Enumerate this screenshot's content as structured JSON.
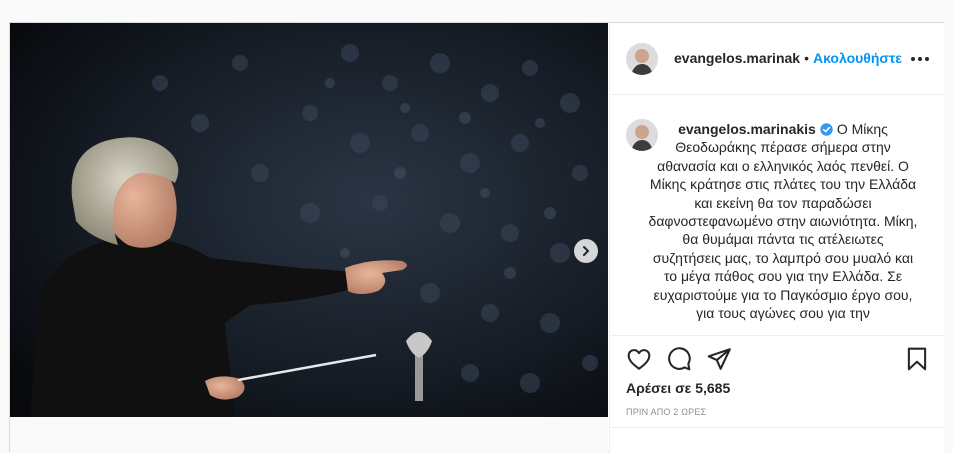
{
  "post": {
    "author": "evangelos.marinakis",
    "header_author": "evangelos.marinak",
    "header_separator": "•",
    "follow_label": "Ακολουθήστε",
    "caption_text": "Ο Μίκης Θεοδωράκης πέρασε σήμερα στην αθανασία και ο ελληνικός λαός πενθεί. Ο Μίκης κράτησε στις πλάτες του την Ελλάδα και εκείνη θα τον παραδώσει δαφνοστεφανωμένο στην αιωνιότητα. Μίκη, θα θυμάμαι πάντα τις ατέλειωτες συζητήσεις μας, το λαμπρό σου μυαλό και το μέγα πάθος σου για την Ελλάδα. Σε ευχαριστούμε για το Παγκόσμιο έργο σου, για τους αγώνες σου για την",
    "likes_label": "Αρέσει σε 5,685",
    "time_ago": "ΠΡΙΝ ΑΠΟ 2 ΩΡΕΣ"
  },
  "icons": {
    "like": "heart-icon",
    "comment": "comment-icon",
    "share": "share-icon",
    "save": "bookmark-icon",
    "more": "more-options-icon",
    "next": "chevron-right-icon",
    "verified": "verified-badge-icon"
  },
  "colors": {
    "link_blue": "#0095f6",
    "verified_blue": "#3897f0",
    "border": "#dbdbdb",
    "muted_text": "#8e8e8e"
  }
}
